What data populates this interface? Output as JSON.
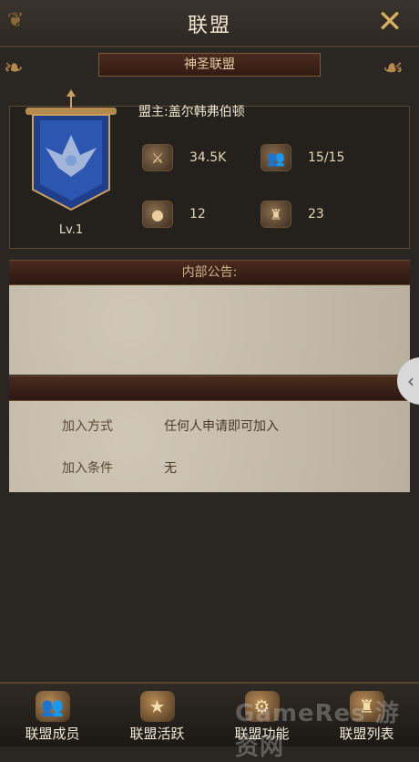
{
  "header": {
    "title": "联盟",
    "close_icon": "close-icon"
  },
  "alliance": {
    "name": "神圣联盟",
    "level": "Lv.1",
    "leader": "盟主:盖尔韩弗伯顿",
    "stats": [
      {
        "icon": "crossed-swords-icon",
        "value": "34.5K"
      },
      {
        "icon": "members-icon",
        "value": "15/15"
      },
      {
        "icon": "gold-coins-icon",
        "value": "12"
      },
      {
        "icon": "castle-scroll-icon",
        "value": "23"
      }
    ]
  },
  "notice": {
    "title": "内部公告:",
    "content": ""
  },
  "join": {
    "method_label": "加入方式",
    "method_value": "任何人申请即可加入",
    "condition_label": "加入条件",
    "condition_value": "无"
  },
  "nav": [
    {
      "label": "联盟成员",
      "icon": "members-icon"
    },
    {
      "label": "联盟活跃",
      "icon": "star-shield-icon"
    },
    {
      "label": "联盟功能",
      "icon": "gear-icon"
    },
    {
      "label": "联盟列表",
      "icon": "castle-icon"
    }
  ],
  "watermark": "GameRes 游资网"
}
